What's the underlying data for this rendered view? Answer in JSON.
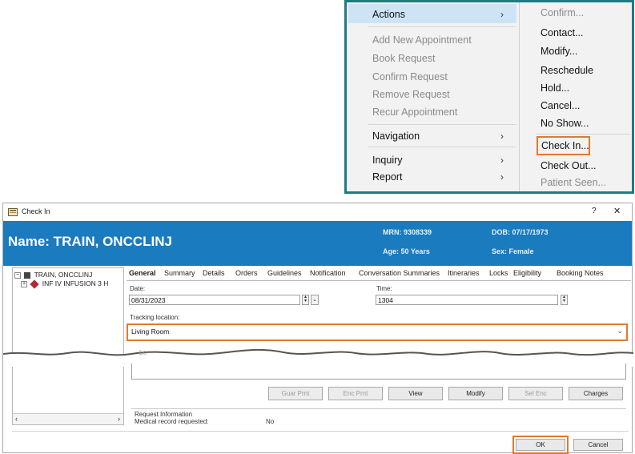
{
  "menu": {
    "main": {
      "actions": "Actions",
      "disabled_items": [
        "Add New Appointment",
        "Book Request",
        "Confirm Request",
        "Remove Request",
        "Recur Appointment"
      ],
      "navigation": "Navigation",
      "inquiry": "Inquiry",
      "report": "Report"
    },
    "sub": {
      "confirm": "Confirm...",
      "contact": "Contact...",
      "modify": "Modify...",
      "reschedule": "Reschedule",
      "hold": "Hold...",
      "cancel": "Cancel...",
      "no_show": "No Show...",
      "check_in": "Check In...",
      "check_out": "Check Out...",
      "patient_seen": "Patient Seen..."
    },
    "border_color": "#1e7b84",
    "highlight_color": "#e4782d"
  },
  "dialog": {
    "title": "Check In",
    "help": "?",
    "close": "✕",
    "banner": {
      "name": "Name: TRAIN, ONCCLINJ",
      "mrn": "MRN: 9308339",
      "dob": "DOB: 07/17/1973",
      "age": "Age: 50 Years",
      "sex": "Sex: Female",
      "color": "#1a7bbf"
    },
    "tree": {
      "root": "TRAIN, ONCCLINJ",
      "child": "INF IV INFUSION 3 H"
    },
    "tabs": [
      "General",
      "Summary",
      "Details",
      "Orders",
      "Guidelines",
      "Notification",
      "Conversation Summaries",
      "Itineraries",
      "Locks",
      "Eligibility",
      "Booking Notes"
    ],
    "general": {
      "date_label": "Date:",
      "date_value": "08/31/2023",
      "time_label": "Time:",
      "time_value": "1304",
      "tracking_label": "Tracking location:",
      "tracking_value": "Living Room",
      "hidden_label": "Lo"
    },
    "buttons": {
      "guar_prnt": "Guar Prnt",
      "enc_prnt": "Enc Prnt",
      "view": "View",
      "modify": "Modify",
      "sel_enc": "Sel Enc",
      "charges": "Charges"
    },
    "request": {
      "section": "Request Information",
      "medical_label": "Medical record requested:",
      "medical_value": "No"
    },
    "ok": "OK",
    "cancel": "Cancel"
  }
}
